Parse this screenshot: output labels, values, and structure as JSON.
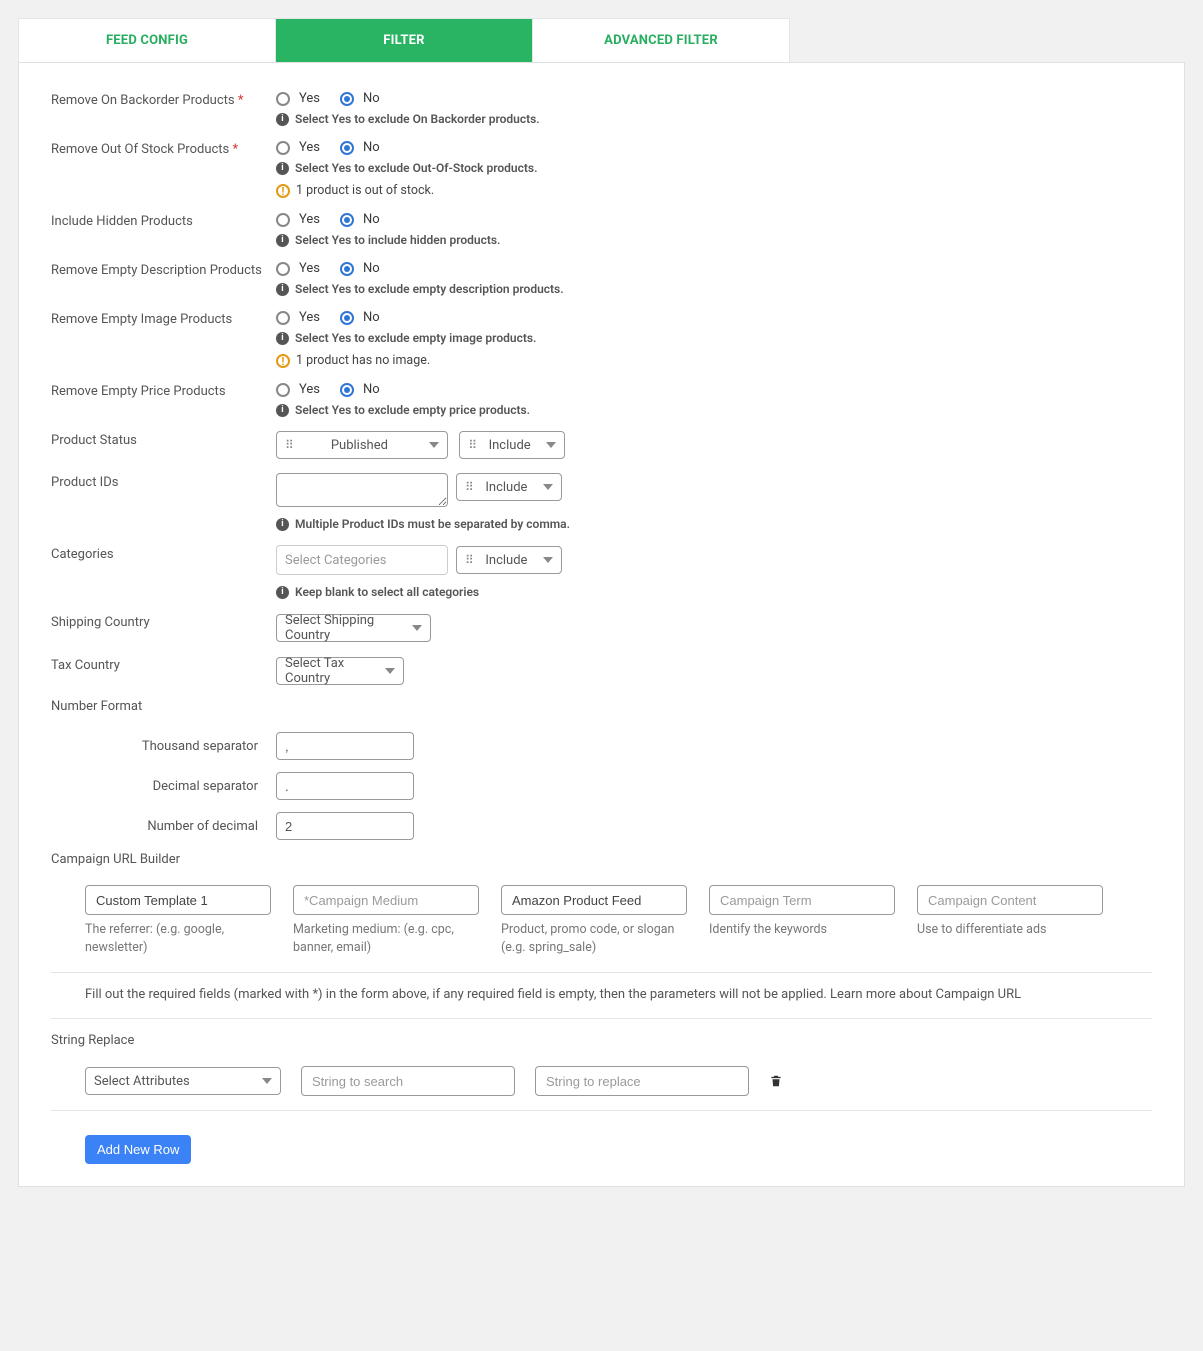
{
  "tabs": {
    "feed_config": "FEED CONFIG",
    "filter": "FILTER",
    "advanced_filter": "ADVANCED FILTER"
  },
  "radio": {
    "yes": "Yes",
    "no": "No"
  },
  "include_option": "Include",
  "fields": {
    "remove_backorder": {
      "label": "Remove On Backorder Products",
      "help": "Select Yes to exclude On Backorder products."
    },
    "remove_oos": {
      "label": "Remove Out Of Stock Products",
      "help": "Select Yes to exclude Out-Of-Stock products.",
      "warn": "1 product is out of stock."
    },
    "include_hidden": {
      "label": "Include Hidden Products",
      "help": "Select Yes to include hidden products."
    },
    "remove_empty_desc": {
      "label": "Remove Empty Description Products",
      "help": "Select Yes to exclude empty description products."
    },
    "remove_empty_image": {
      "label": "Remove Empty Image Products",
      "help": "Select Yes to exclude empty image products.",
      "warn": "1 product has no image."
    },
    "remove_empty_price": {
      "label": "Remove Empty Price Products",
      "help": "Select Yes to exclude empty price products."
    },
    "product_status": {
      "label": "Product Status",
      "value": "Published"
    },
    "product_ids": {
      "label": "Product IDs",
      "help": "Multiple Product IDs must be separated by comma."
    },
    "categories": {
      "label": "Categories",
      "placeholder": "Select Categories",
      "help": "Keep blank to select all categories"
    },
    "shipping_country": {
      "label": "Shipping Country",
      "placeholder": "Select Shipping Country"
    },
    "tax_country": {
      "label": "Tax Country",
      "placeholder": "Select Tax Country"
    },
    "number_format": {
      "label": "Number Format",
      "thousand_label": "Thousand separator",
      "thousand_value": ",",
      "decimal_label": "Decimal separator",
      "decimal_value": ".",
      "numdec_label": "Number of decimal",
      "numdec_value": "2"
    }
  },
  "campaign": {
    "heading": "Campaign URL Builder",
    "cols": [
      {
        "value": "Custom Template 1",
        "placeholder": "",
        "help": "The referrer: (e.g. google, newsletter)"
      },
      {
        "value": "",
        "placeholder": "*Campaign Medium",
        "help": "Marketing medium: (e.g. cpc, banner, email)"
      },
      {
        "value": "Amazon Product Feed",
        "placeholder": "",
        "help": "Product, promo code, or slogan (e.g. spring_sale)"
      },
      {
        "value": "",
        "placeholder": "Campaign Term",
        "help": "Identify the keywords"
      },
      {
        "value": "",
        "placeholder": "Campaign Content",
        "help": "Use to differentiate ads"
      }
    ],
    "note": "Fill out the required fields (marked with *) in the form above, if any required field is empty, then the parameters will not be applied. Learn more about Campaign URL"
  },
  "string_replace": {
    "heading": "String Replace",
    "attr_placeholder": "Select Attributes",
    "search_placeholder": "String to search",
    "replace_placeholder": "String to replace",
    "add_row": "Add New Row"
  }
}
